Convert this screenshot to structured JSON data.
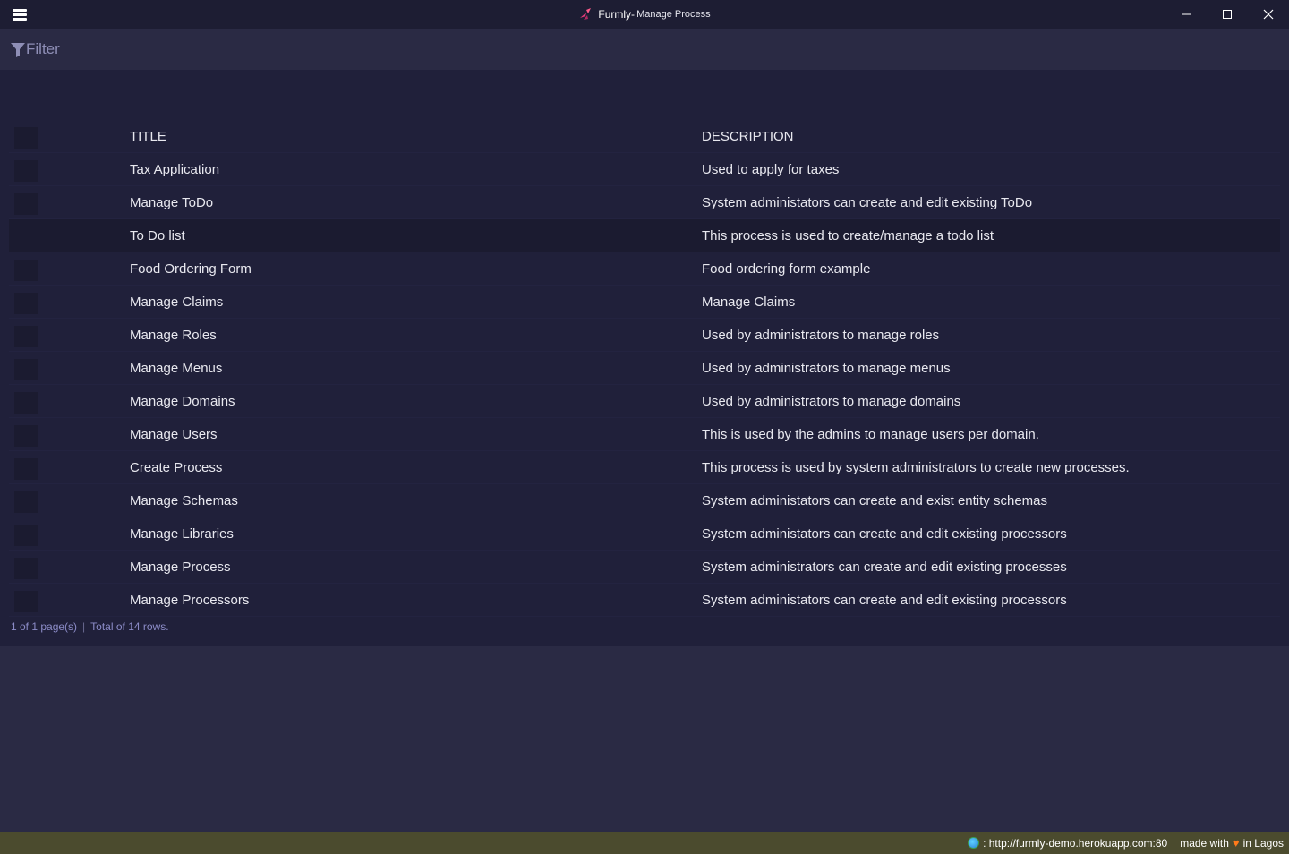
{
  "titlebar": {
    "app_name": "Furmly-",
    "subtitle": " Manage Process",
    "icons": {
      "menu": "hamburger-menu-icon",
      "logo": "furmly-logo-icon",
      "minimize": "minimize-icon",
      "maximize": "maximize-icon",
      "close": "close-icon"
    }
  },
  "filter": {
    "label": "Filter",
    "icon": "filter-funnel-icon",
    "color": "#8e8eb6"
  },
  "table": {
    "columns": {
      "title": "TITLE",
      "description": "DESCRIPTION"
    },
    "rows": [
      {
        "title": "Tax Application",
        "description": "Used to apply for taxes"
      },
      {
        "title": "Manage ToDo",
        "description": "System administators can create and edit existing ToDo"
      },
      {
        "title": "To Do list",
        "description": "This process is used to create/manage a todo list"
      },
      {
        "title": "Food Ordering Form",
        "description": "Food ordering form example"
      },
      {
        "title": "Manage Claims",
        "description": "Manage Claims"
      },
      {
        "title": "Manage Roles",
        "description": "Used by administrators to manage roles"
      },
      {
        "title": "Manage Menus",
        "description": "Used by administrators to manage menus"
      },
      {
        "title": "Manage Domains",
        "description": "Used by administrators to manage domains"
      },
      {
        "title": "Manage Users",
        "description": "This is used by the admins to manage users per domain."
      },
      {
        "title": "Create Process",
        "description": "This process is used by system administrators to create new processes."
      },
      {
        "title": "Manage Schemas",
        "description": "System administators can create and exist entity schemas"
      },
      {
        "title": "Manage Libraries",
        "description": "System administators can create and edit existing processors"
      },
      {
        "title": "Manage Process",
        "description": "System administrators can create and edit existing processes"
      },
      {
        "title": "Manage Processors",
        "description": "System administators can create and edit existing processors"
      }
    ]
  },
  "pager": {
    "pages": "1 of 1 page(s)",
    "separator": "|",
    "total": "Total of 14 rows."
  },
  "statusbar": {
    "url": ": http://furmly-demo.herokuapp.com:80",
    "made_with": "made with",
    "location": "in Lagos",
    "heart_color": "#ff7a1a"
  },
  "colors": {
    "titlebar": "#1d1d33",
    "background": "#2a2a44",
    "panel": "#20203a",
    "statusbar": "#4b4b2e",
    "accent": "#8c8cc8"
  }
}
